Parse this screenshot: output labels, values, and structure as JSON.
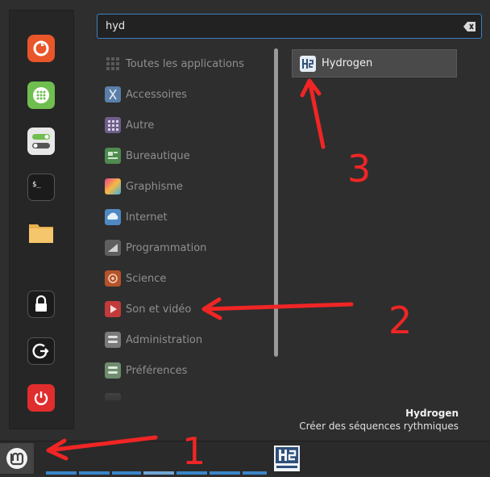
{
  "search": {
    "value": "hyd",
    "placeholder": ""
  },
  "favorites": [
    {
      "name": "firefox-icon",
      "color": "#e8562a"
    },
    {
      "name": "software-manager-icon",
      "color": "#5fb342"
    },
    {
      "name": "settings-toggle-icon",
      "color": "#e8e8e8"
    },
    {
      "name": "terminal-icon",
      "color": "#1e1e1e"
    },
    {
      "name": "folder-icon",
      "color": "#f0c163"
    },
    {
      "name": "lock-icon",
      "color": "#1e1e1e"
    },
    {
      "name": "logout-icon",
      "color": "#1e1e1e"
    },
    {
      "name": "power-icon",
      "color": "#e02d2d"
    }
  ],
  "categories": [
    {
      "label": "Toutes les applications",
      "icon": "grid-icon",
      "color": "#555555"
    },
    {
      "label": "Accessoires",
      "icon": "accessories-icon",
      "color": "#5a7fa8"
    },
    {
      "label": "Autre",
      "icon": "other-icon",
      "color": "#6e5f8a"
    },
    {
      "label": "Bureautique",
      "icon": "office-icon",
      "color": "#4f8a4f"
    },
    {
      "label": "Graphisme",
      "icon": "graphics-icon",
      "color": "#c05a9a"
    },
    {
      "label": "Internet",
      "icon": "internet-icon",
      "color": "#4f89c2"
    },
    {
      "label": "Programmation",
      "icon": "programming-icon",
      "color": "#6a6a6a"
    },
    {
      "label": "Science",
      "icon": "science-icon",
      "color": "#b5532a"
    },
    {
      "label": "Son et vidéo",
      "icon": "sound-video-icon",
      "color": "#c23a3a"
    },
    {
      "label": "Administration",
      "icon": "administration-icon",
      "color": "#7a7a7a"
    },
    {
      "label": "Préférences",
      "icon": "preferences-icon",
      "color": "#6f8c6f"
    }
  ],
  "result": {
    "label": "Hydrogen",
    "icon": "hydrogen-icon"
  },
  "description": {
    "title": "Hydrogen",
    "text": "Créer des séquences rythmiques"
  },
  "annotations": {
    "one": "1",
    "two": "2",
    "three": "3"
  },
  "colors": {
    "accent": "#3d7fbf",
    "annotation": "#f02525",
    "menu_bg": "#2e2e2e"
  }
}
